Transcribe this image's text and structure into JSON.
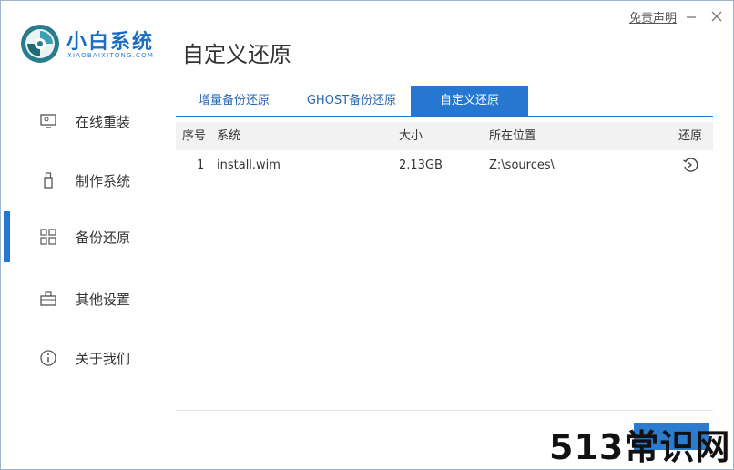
{
  "brand": {
    "name": "小白系统",
    "subtitle": "XIAOBAIXITONG.COM"
  },
  "header": {
    "title": "自定义还原",
    "disclaimer": "免责声明"
  },
  "window": {
    "minimize_icon": "minimize-icon",
    "close_icon": "close-icon"
  },
  "sidebar": {
    "items": [
      {
        "label": "在线重装",
        "icon": "monitor-icon",
        "active": false
      },
      {
        "label": "制作系统",
        "icon": "usb-drive-icon",
        "active": false
      },
      {
        "label": "备份还原",
        "icon": "grid-restore-icon",
        "active": true
      },
      {
        "label": "其他设置",
        "icon": "toolbox-icon",
        "active": false
      },
      {
        "label": "关于我们",
        "icon": "info-icon",
        "active": false
      }
    ]
  },
  "tabs": [
    {
      "label": "增量备份还原",
      "active": false
    },
    {
      "label": "GHOST备份还原",
      "active": false
    },
    {
      "label": "自定义还原",
      "active": true
    }
  ],
  "table": {
    "columns": [
      "序号",
      "系统",
      "大小",
      "所在位置",
      "还原"
    ],
    "rows": [
      {
        "index": "1",
        "system": "install.wim",
        "size": "2.13GB",
        "location": "Z:\\sources\\",
        "action_icon": "restore-icon"
      }
    ]
  },
  "watermark": "513常识网",
  "colors": {
    "accent": "#2577cf",
    "tab_text": "#2868b3",
    "header_bg": "#f2f2f2"
  }
}
